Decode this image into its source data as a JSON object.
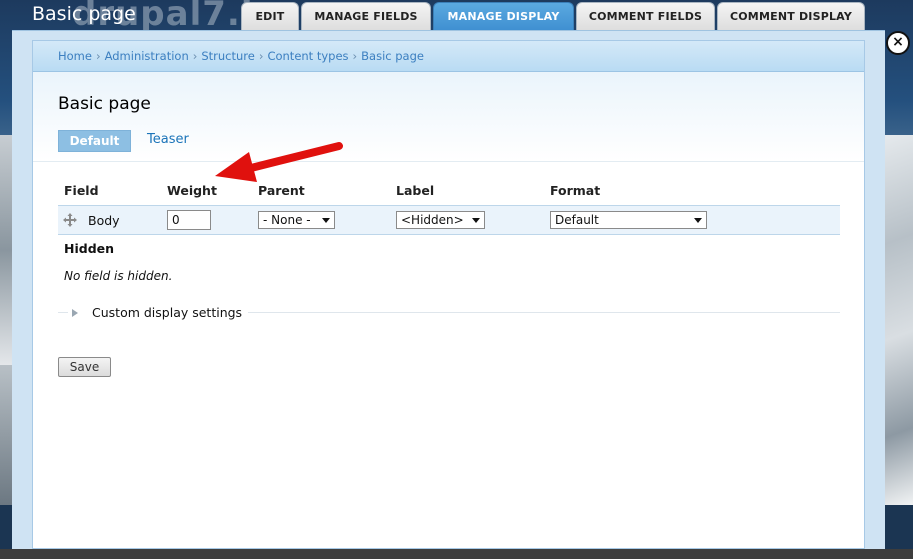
{
  "background": {
    "page_title": "Basic page",
    "site_name": "drupal7.i"
  },
  "tabs": [
    {
      "label": "EDIT",
      "active": false
    },
    {
      "label": "MANAGE FIELDS",
      "active": false
    },
    {
      "label": "MANAGE DISPLAY",
      "active": true
    },
    {
      "label": "COMMENT FIELDS",
      "active": false
    },
    {
      "label": "COMMENT DISPLAY",
      "active": false
    }
  ],
  "breadcrumb": [
    "Home",
    "Administration",
    "Structure",
    "Content types",
    "Basic page"
  ],
  "breadcrumb_separator": "›",
  "page_title": "Basic page",
  "subtabs": {
    "default": "Default",
    "teaser": "Teaser"
  },
  "table": {
    "headers": [
      "Field",
      "Weight",
      "Parent",
      "Label",
      "Format"
    ],
    "rows": [
      {
        "field": "Body",
        "weight": "0",
        "parent": "- None -",
        "label": "<Hidden>",
        "format": "Default"
      }
    ]
  },
  "hidden": {
    "heading": "Hidden",
    "empty_text": "No field is hidden."
  },
  "custom_settings": "Custom display settings",
  "save_label": "Save",
  "close_label": "×",
  "colors": {
    "accent": "#3e8ed0",
    "link": "#1b74b9",
    "annotation_arrow": "#e0110e"
  }
}
